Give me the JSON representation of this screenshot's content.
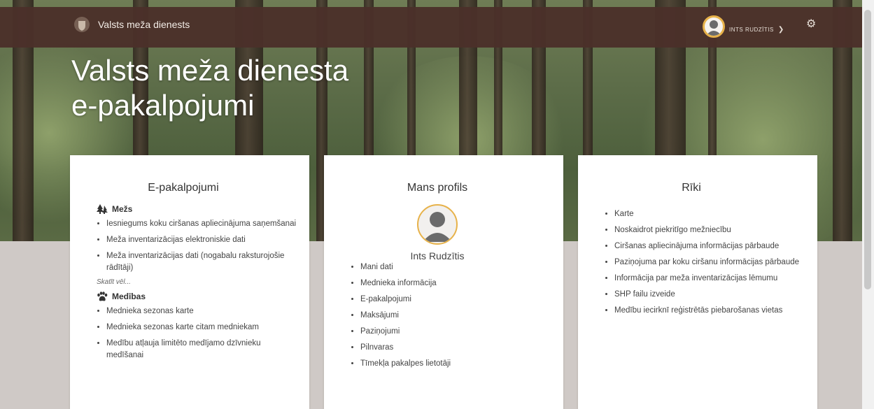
{
  "header": {
    "brand_name": "Valsts meža dienests",
    "user_name": "INTS RUDZĪTIS",
    "chevron_icon": "chevron-down-icon",
    "settings_icon": "gear-icon"
  },
  "hero": {
    "title_line1": "Valsts meža dienesta",
    "title_line2": "e-pakalpojumi"
  },
  "cards": {
    "epakalpojumi": {
      "title": "E-pakalpojumi",
      "mezs": {
        "label": "Mežs",
        "items": [
          "Iesniegums koku ciršanas apliecinājuma saņemšanai",
          "Meža inventarizācijas elektroniskie dati",
          "Meža inventarizācijas dati (nogabalu raksturojošie rādītāji)"
        ],
        "more": "Skatīt vēl..."
      },
      "medibas": {
        "label": "Medības",
        "items": [
          "Mednieka sezonas karte",
          "Mednieka sezonas karte citam medniekam",
          "Medību atļauja limitēto medījamo dzīvnieku medīšanai"
        ]
      }
    },
    "profile": {
      "title": "Mans profils",
      "name": "Ints Rudzītis",
      "items": [
        "Mani dati",
        "Mednieka informācija",
        "E-pakalpojumi",
        "Maksājumi",
        "Paziņojumi",
        "Pilnvaras",
        "Tīmekļa pakalpes lietotāji"
      ]
    },
    "riki": {
      "title": "Rīki",
      "items": [
        "Karte",
        "Noskaidrot piekritīgo mežniecību",
        "Ciršanas apliecinājuma informācijas pārbaude",
        "Paziņojuma par koku ciršanu informācijas pārbaude",
        "Informācija par meža inventarizācijas lēmumu",
        "SHP failu izveide",
        "Medību iecirknī reģistrētās piebarošanas vietas"
      ]
    }
  },
  "colors": {
    "header_bg": "#4b302a",
    "accent": "#e7b24a",
    "card_bg": "#ffffff",
    "page_bg": "#cfc9c6"
  }
}
